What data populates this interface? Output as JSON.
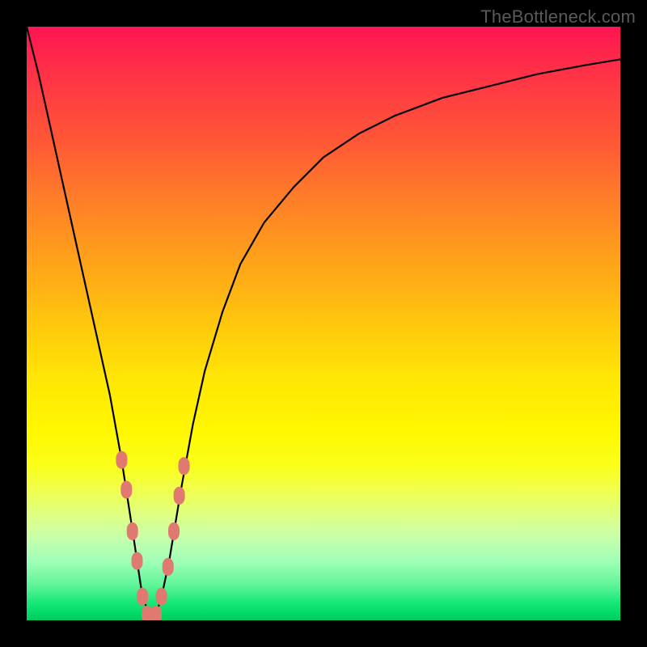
{
  "watermark": "TheBottleneck.com",
  "colors": {
    "frame": "#000000",
    "curve": "#000000",
    "marker": "#e07a70",
    "gradient_top": "#ff1452",
    "gradient_bottom": "#00cc5c"
  },
  "chart_data": {
    "type": "line",
    "title": "",
    "xlabel": "",
    "ylabel": "",
    "xlim": [
      0,
      100
    ],
    "ylim": [
      0,
      100
    ],
    "grid": false,
    "legend": false,
    "series": [
      {
        "name": "bottleneck-curve",
        "x": [
          0,
          2,
          4,
          6,
          8,
          10,
          12,
          14,
          16,
          18,
          19.5,
          21,
          22.5,
          24,
          26,
          28,
          30,
          33,
          36,
          40,
          45,
          50,
          56,
          62,
          70,
          78,
          86,
          94,
          100
        ],
        "values": [
          100,
          92,
          83,
          74,
          65,
          56,
          47,
          38,
          27,
          14,
          4,
          0,
          3,
          10,
          22,
          33,
          42,
          52,
          60,
          67,
          73,
          78,
          82,
          85,
          88,
          90,
          92,
          93.5,
          94.5
        ]
      }
    ],
    "markers": {
      "name": "datapoints",
      "description": "pink rounded clusters near valley bottom",
      "points": [
        {
          "x": 16.0,
          "y": 27
        },
        {
          "x": 16.8,
          "y": 22
        },
        {
          "x": 17.8,
          "y": 15
        },
        {
          "x": 18.6,
          "y": 10
        },
        {
          "x": 19.5,
          "y": 4
        },
        {
          "x": 20.3,
          "y": 1
        },
        {
          "x": 21.0,
          "y": 0
        },
        {
          "x": 21.8,
          "y": 1
        },
        {
          "x": 22.7,
          "y": 4
        },
        {
          "x": 23.8,
          "y": 9
        },
        {
          "x": 24.8,
          "y": 15
        },
        {
          "x": 25.7,
          "y": 21
        },
        {
          "x": 26.5,
          "y": 26
        }
      ]
    }
  }
}
